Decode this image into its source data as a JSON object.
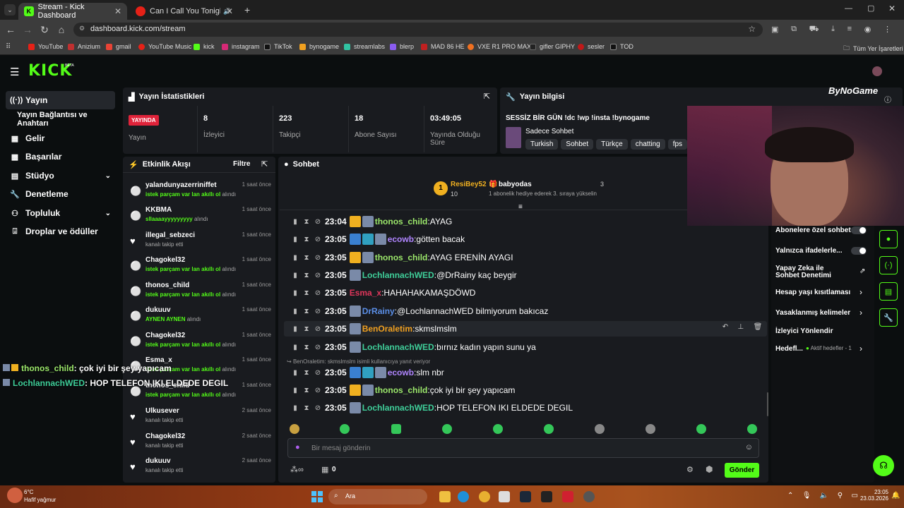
{
  "browser": {
    "tabs": [
      {
        "title": "Stream - Kick Dashboard",
        "active": true
      },
      {
        "title": "Can I Call You Tonight? | Yo",
        "active": false
      }
    ],
    "url": "dashboard.kick.com/stream",
    "bookmarks": [
      "YouTube",
      "Anizium",
      "gmail",
      "YouTube Music",
      "kick",
      "instagram",
      "TikTok",
      "bynogame",
      "streamlabs",
      "blerp",
      "MAD 86 HE",
      "VXE R1 PRO MAX",
      "gifler GIPHY",
      "sesler",
      "TOD"
    ],
    "all_bookmarks": "Tüm Yer İşaretleri"
  },
  "kick": {
    "logo": "KICK",
    "beta": "BETA",
    "nav": [
      {
        "label": "Yayın",
        "icon": "broadcast-icon"
      },
      {
        "label": "Yayın Bağlantısı ve Anahtarı",
        "icon": ""
      },
      {
        "label": "Gelir",
        "icon": "chart-icon"
      },
      {
        "label": "Başarılar",
        "icon": "grid-icon"
      },
      {
        "label": "Stüdyo",
        "icon": "studio-icon"
      },
      {
        "label": "Denetleme",
        "icon": "wrench-icon"
      },
      {
        "label": "Topluluk",
        "icon": "community-icon"
      },
      {
        "label": "Droplar ve ödüller",
        "icon": "gift-icon"
      }
    ],
    "stats": {
      "title": "Yayın İstatistikleri",
      "live_badge": "YAYINDA",
      "live_label": "Yayın",
      "items": [
        {
          "value": "8",
          "label": "İzleyici"
        },
        {
          "value": "223",
          "label": "Takipçi"
        },
        {
          "value": "18",
          "label": "Abone Sayısı"
        },
        {
          "value": "03:49:05",
          "label": "Yayında Olduğu Süre"
        }
      ]
    },
    "info": {
      "title": "Yayın bilgisi",
      "stream_title": "SESSİZ BİR GÜN !dc !wp !insta !bynogame",
      "category": "Sadece Sohbet",
      "tags": [
        "Turkish",
        "Sohbet",
        "Türkçe",
        "chatting",
        "fps"
      ]
    },
    "activity": {
      "title": "Etkinlik Akışı",
      "filter": "Filtre",
      "items": [
        {
          "name": "yalandunyazerriniffet",
          "msg": "istek parçam var lan akıllı ol",
          "suffix": "alındı",
          "time": "1 saat önce",
          "green": true
        },
        {
          "name": "KKBMA",
          "msg": "sllaaaayyyyyyyyy",
          "suffix": "alındı",
          "time": "1 saat önce",
          "green": true
        },
        {
          "name": "illegal_sebzeci",
          "msg": "kanalı takip etti",
          "suffix": "",
          "time": "1 saat önce",
          "green": false
        },
        {
          "name": "Chagokel32",
          "msg": "istek parçam var lan akıllı ol",
          "suffix": "alındı",
          "time": "1 saat önce",
          "green": true
        },
        {
          "name": "thonos_child",
          "msg": "istek parçam var lan akıllı ol",
          "suffix": "alındı",
          "time": "1 saat önce",
          "green": true
        },
        {
          "name": "dukuuv",
          "msg": "AYNEN AYNEN",
          "suffix": "alındı",
          "time": "1 saat önce",
          "green": true
        },
        {
          "name": "Chagokel32",
          "msg": "istek parçam var lan akıllı ol",
          "suffix": "alındı",
          "time": "1 saat önce",
          "green": true
        },
        {
          "name": "Esma_x",
          "msg": "istek parçam var lan akıllı ol",
          "suffix": "alındı",
          "time": "1 saat önce",
          "green": true
        },
        {
          "name": "thonos_child",
          "msg": "istek parçam var lan akıllı ol",
          "suffix": "alındı",
          "time": "1 saat önce",
          "green": true
        },
        {
          "name": "Ulkusever",
          "msg": "kanalı takip etti",
          "suffix": "",
          "time": "2 saat önce",
          "green": false
        },
        {
          "name": "Chagokel32",
          "msg": "kanalı takip etti",
          "suffix": "",
          "time": "2 saat önce",
          "green": false
        },
        {
          "name": "dukuuv",
          "msg": "kanalı takip etti",
          "suffix": "",
          "time": "2 saat önce",
          "green": false
        }
      ]
    },
    "chat": {
      "title": "Sohbet",
      "pinned": {
        "user1": "ResiBey52",
        "count1": "10",
        "user2": "babyodas",
        "count2": "3",
        "note": "1 abonelik hediye ederek 3. sıraya yükselin"
      },
      "messages": [
        {
          "time": "23:04",
          "user": "thonos_child",
          "color": "#9ce86b",
          "text": "AYAG"
        },
        {
          "time": "23:05",
          "user": "ecowb",
          "color": "#b085ff",
          "text": "götten bacak"
        },
        {
          "time": "23:05",
          "user": "thonos_child",
          "color": "#9ce86b",
          "text": "AYAG ERENİN AYAGI"
        },
        {
          "time": "23:05",
          "user": "LochlannachWED",
          "color": "#3fcf9a",
          "text": "@DrRainy kaç beygir"
        },
        {
          "time": "23:05",
          "user": "Esma_x",
          "color": "#e0365b",
          "text": "HAHAHAKAMAŞDÖWD"
        },
        {
          "time": "23:05",
          "user": "DrRainy",
          "color": "#5b8fe8",
          "text": "@LochlannachWED bilmiyorum bakıcaz"
        },
        {
          "time": "23:05",
          "user": "BenOraletim",
          "color": "#f0a020",
          "text": "skmslmslm"
        },
        {
          "time": "23:05",
          "user": "LochlannachWED",
          "color": "#3fcf9a",
          "text": "bırnız kadın yapın sunu ya"
        },
        {
          "time": "23:05",
          "user": "ecowb",
          "color": "#b085ff",
          "text": "slm nbr"
        },
        {
          "time": "23:05",
          "user": "thonos_child",
          "color": "#9ce86b",
          "text": "çok iyi bir şey yapıcam"
        },
        {
          "time": "23:05",
          "user": "LochlannachWED",
          "color": "#3fcf9a",
          "text": "HOP TELEFON IKI ELDEDE DEGIL"
        }
      ],
      "reply_note": "BenOraletim: skmslmslm isimli kullanıcıya yanıt veriyor",
      "input_placeholder": "Bir mesaj gönderin",
      "points": "0",
      "send": "Gönder"
    },
    "settings": [
      "Abonelere özel sohbet",
      "Yalnızca ifadelerle...",
      "Yapay Zeka ile Sohbet Denetimi",
      "Hesap yaşı kısıtlaması",
      "Yasaklanmış kelimeler",
      "İzleyici Yönlendir",
      "Hedefl...",
      "Aktif hedefler - 1"
    ],
    "overlay": {
      "brand": "ByNoGame",
      "chat1_user": "thonos_child",
      "chat1_text": ": çok iyi bir şey yapıcam",
      "chat2_user": "LochlannachWED",
      "chat2_text": ": HOP TELEFON IKI ELDEDE DEGIL"
    }
  },
  "taskbar": {
    "weather_temp": "6°C",
    "weather_desc": "Hafif yağmur",
    "search": "Ara",
    "time": "23:05",
    "date": "23.03.2026"
  }
}
